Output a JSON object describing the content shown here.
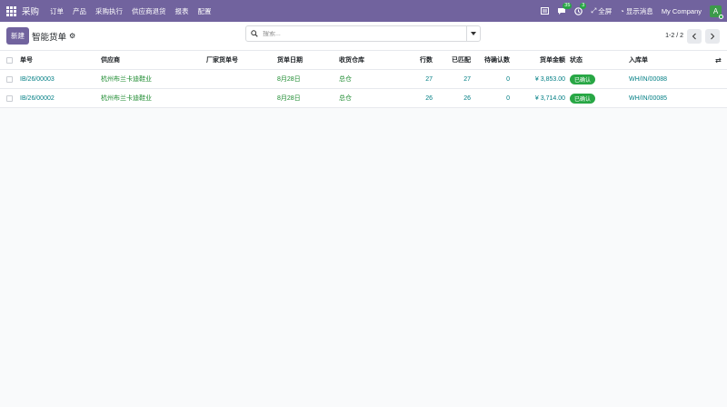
{
  "app": {
    "name": "采购",
    "menu": [
      "订单",
      "产品",
      "采购执行",
      "供应商退货",
      "报表",
      "配置"
    ]
  },
  "navbar": {
    "messages_count": "35",
    "activities_count": "3",
    "fullscreen_label": "全屏",
    "show_messages_label": "显示消息",
    "company": "My Company",
    "avatar_initial": "A"
  },
  "control": {
    "new_button": "新建",
    "title": "智能货单",
    "search_placeholder": "搜索...",
    "pager": "1-2 / 2"
  },
  "table": {
    "headers": {
      "number": "单号",
      "vendor": "供应商",
      "vendor_ref": "厂家货单号",
      "date": "货单日期",
      "warehouse": "收货仓库",
      "lines": "行数",
      "matched": "已匹配",
      "pending": "待确认数",
      "amount": "货单金额",
      "status": "状态",
      "receipt": "入库单"
    },
    "rows": [
      {
        "number": "IB/26/00003",
        "vendor": "杭州布兰卡迪鞋业",
        "vendor_ref": "",
        "date": "8月28日",
        "warehouse": "总仓",
        "lines": "27",
        "matched": "27",
        "pending": "0",
        "amount": "¥ 3,853.00",
        "status": "已确认",
        "receipt": "WH/IN/00088"
      },
      {
        "number": "IB/26/00002",
        "vendor": "杭州布兰卡迪鞋业",
        "vendor_ref": "",
        "date": "8月28日",
        "warehouse": "总仓",
        "lines": "26",
        "matched": "26",
        "pending": "0",
        "amount": "¥ 3,714.00",
        "status": "已确认",
        "receipt": "WH/IN/00085"
      }
    ]
  },
  "colors": {
    "brand": "#71639e",
    "link": "#017e84",
    "status": "#28a745"
  }
}
